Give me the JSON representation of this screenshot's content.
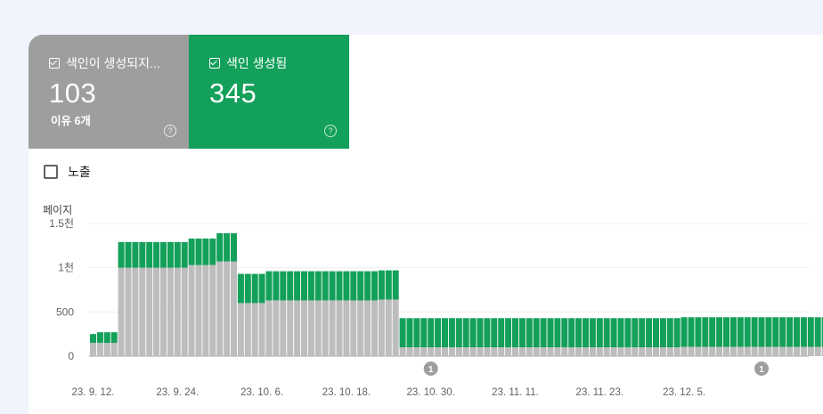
{
  "tiles": {
    "not_indexed": {
      "label": "색인이 생성되지...",
      "value": "103",
      "sub": "이유 6개",
      "help": "?",
      "color": "#9e9e9e"
    },
    "indexed": {
      "label": "색인 생성됨",
      "value": "345",
      "help": "?",
      "color": "#13a05a"
    }
  },
  "impressions_label": "노출",
  "chart_data": {
    "type": "bar",
    "stacked": true,
    "ylabel": "페이지",
    "yticks": [
      "0",
      "500",
      "1천",
      "1.5천"
    ],
    "ylim": [
      0,
      1500
    ],
    "xticks": [
      "23. 9. 12.",
      "23. 9. 24.",
      "23. 10. 6.",
      "23. 10. 18.",
      "23. 10. 30.",
      "23. 11. 11.",
      "23. 11. 23.",
      "23. 12. 5."
    ],
    "series": [
      {
        "color": "#bdbdbd",
        "values": [
          150,
          150,
          150,
          150,
          1000,
          1000,
          1000,
          1000,
          1000,
          1000,
          1000,
          1000,
          1000,
          1000,
          1030,
          1030,
          1030,
          1030,
          1070,
          1070,
          1070,
          600,
          600,
          600,
          600,
          630,
          630,
          630,
          630,
          630,
          630,
          630,
          630,
          630,
          630,
          630,
          630,
          630,
          630,
          630,
          630,
          640,
          640,
          640,
          100,
          100,
          100,
          100,
          100,
          100,
          100,
          100,
          100,
          100,
          100,
          100,
          100,
          100,
          100,
          100,
          100,
          100,
          100,
          100,
          100,
          100,
          100,
          100,
          100,
          100,
          100,
          100,
          100,
          100,
          100,
          100,
          100,
          100,
          100,
          100,
          100,
          100,
          100,
          100,
          105,
          105,
          105,
          105,
          105,
          105,
          105,
          105,
          105,
          105,
          105,
          105,
          105,
          105,
          105,
          105,
          105,
          105,
          105,
          105,
          105,
          105
        ]
      },
      {
        "color": "#13a05a",
        "values": [
          100,
          120,
          120,
          120,
          290,
          290,
          290,
          290,
          290,
          290,
          290,
          290,
          290,
          290,
          300,
          300,
          300,
          300,
          320,
          320,
          320,
          330,
          330,
          330,
          330,
          330,
          330,
          330,
          330,
          330,
          330,
          330,
          330,
          330,
          330,
          330,
          330,
          330,
          330,
          330,
          330,
          330,
          330,
          330,
          330,
          330,
          330,
          330,
          330,
          330,
          330,
          330,
          330,
          330,
          330,
          330,
          330,
          330,
          330,
          330,
          330,
          330,
          330,
          330,
          330,
          330,
          330,
          330,
          330,
          330,
          330,
          330,
          330,
          330,
          330,
          330,
          330,
          330,
          330,
          330,
          330,
          330,
          330,
          330,
          335,
          335,
          335,
          335,
          335,
          335,
          335,
          335,
          335,
          335,
          335,
          335,
          335,
          335,
          335,
          335,
          335,
          335,
          335,
          335,
          335,
          335
        ]
      }
    ],
    "annotations": [
      {
        "label": "1",
        "at": "23. 10. 30."
      },
      {
        "label": "1",
        "at": "23. 12. 5."
      }
    ],
    "grid": true
  }
}
